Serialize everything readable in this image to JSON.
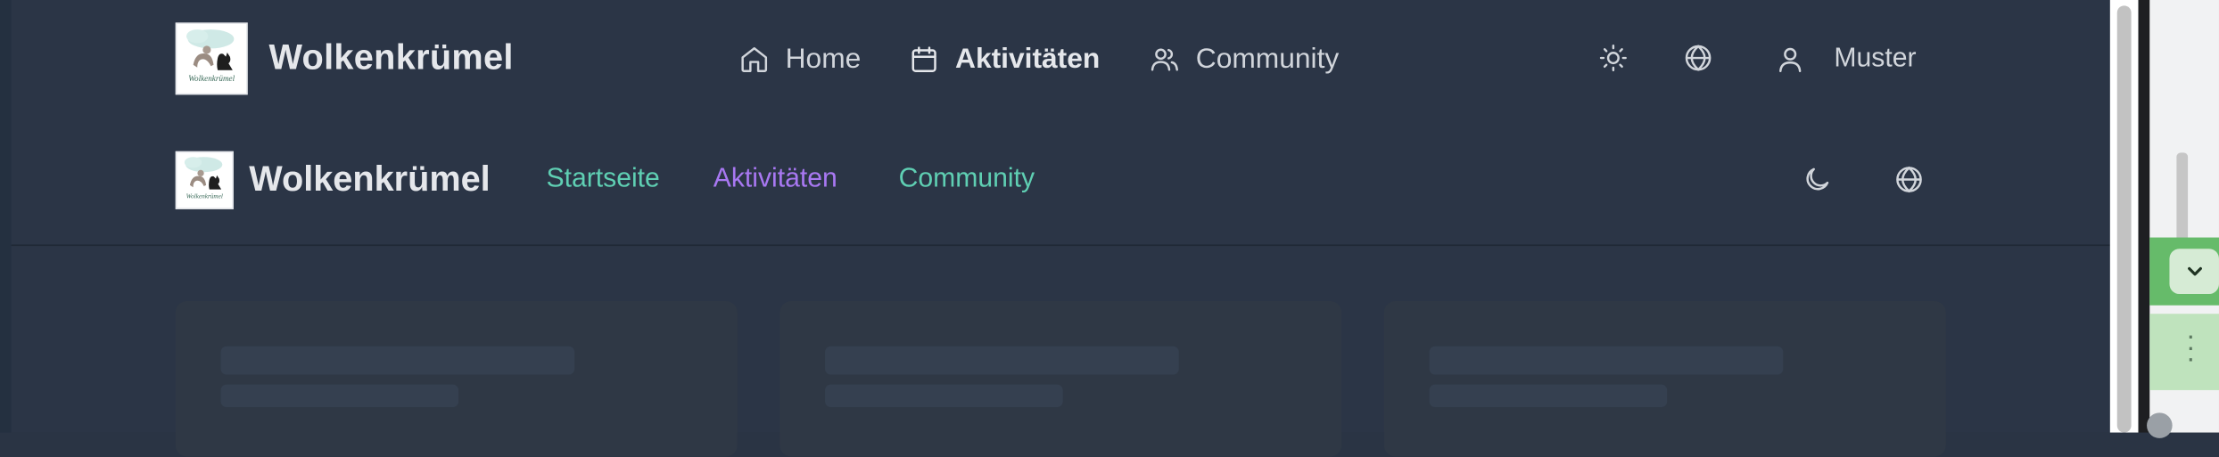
{
  "top_nav": {
    "brand": "Wolkenkrümel",
    "logo_text": "Wolkenkrümel",
    "items": [
      {
        "label": "Home",
        "icon": "home-icon",
        "active": false
      },
      {
        "label": "Aktivitäten",
        "icon": "calendar-icon",
        "active": true
      },
      {
        "label": "Community",
        "icon": "users-icon",
        "active": false
      }
    ],
    "theme_icon": "sun-icon",
    "language_icon": "globe-icon",
    "user": {
      "name": "Muster",
      "icon": "user-icon"
    }
  },
  "second_nav": {
    "brand": "Wolkenkrümel",
    "items": [
      {
        "label": "Startseite",
        "active": false
      },
      {
        "label": "Aktivitäten",
        "active": true
      },
      {
        "label": "Community",
        "active": false
      }
    ],
    "theme_icon": "moon-icon",
    "language_icon": "globe-icon"
  },
  "content": {
    "cards_state": "loading",
    "card_count": 3
  },
  "colors": {
    "background": "#2b3546",
    "link": "#5fcfb3",
    "active_link": "#a878f2",
    "text": "#e5e7eb",
    "side_panel_accent": "#66bb6a"
  }
}
